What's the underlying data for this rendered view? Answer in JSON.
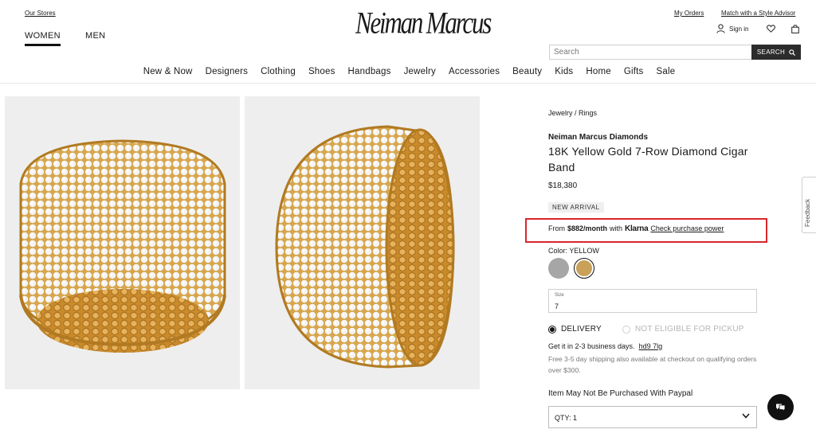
{
  "header": {
    "our_stores": "Our Stores",
    "my_orders": "My Orders",
    "style_advisor": "Match with a Style Advisor",
    "logo": "Neiman Marcus",
    "tabs": [
      {
        "label": "WOMEN",
        "active": true
      },
      {
        "label": "MEN",
        "active": false
      }
    ],
    "sign_in": "Sign in",
    "search_placeholder": "Search",
    "search_button": "SEARCH"
  },
  "nav": [
    "New & Now",
    "Designers",
    "Clothing",
    "Shoes",
    "Handbags",
    "Jewelry",
    "Accessories",
    "Beauty",
    "Kids",
    "Home",
    "Gifts",
    "Sale"
  ],
  "product": {
    "breadcrumb": "Jewelry / Rings",
    "brand": "Neiman Marcus Diamonds",
    "title": "18K Yellow Gold 7-Row Diamond Cigar Band",
    "price": "$18,380",
    "badge": "NEW ARRIVAL",
    "klarna": {
      "from": "From",
      "amount": "$882/month",
      "with": "with",
      "provider": "Klarna",
      "link": "Check purchase power"
    },
    "color_label": "Color: YELLOW",
    "swatches": [
      {
        "name": "silver",
        "color": "#a6a6a6",
        "selected": false
      },
      {
        "name": "yellow",
        "color": "#c9a158",
        "selected": true
      }
    ],
    "size_label": "Size",
    "size_value": "7",
    "delivery_label": "DELIVERY",
    "pickup_label": "NOT ELIGIBLE FOR PICKUP",
    "ship_time": "Get it in 2-3 business days.",
    "zip": "hd9 7lg",
    "ship_note": "Free 3-5 day shipping also available at checkout on qualifying orders over $300.",
    "paypal_note": "Item May Not Be Purchased With Paypal",
    "qty": "QTY: 1"
  },
  "feedback": "Feedback",
  "colors": {
    "accent": "#d9262c",
    "gold": "#c9a158",
    "dark": "#2c2c2c"
  }
}
